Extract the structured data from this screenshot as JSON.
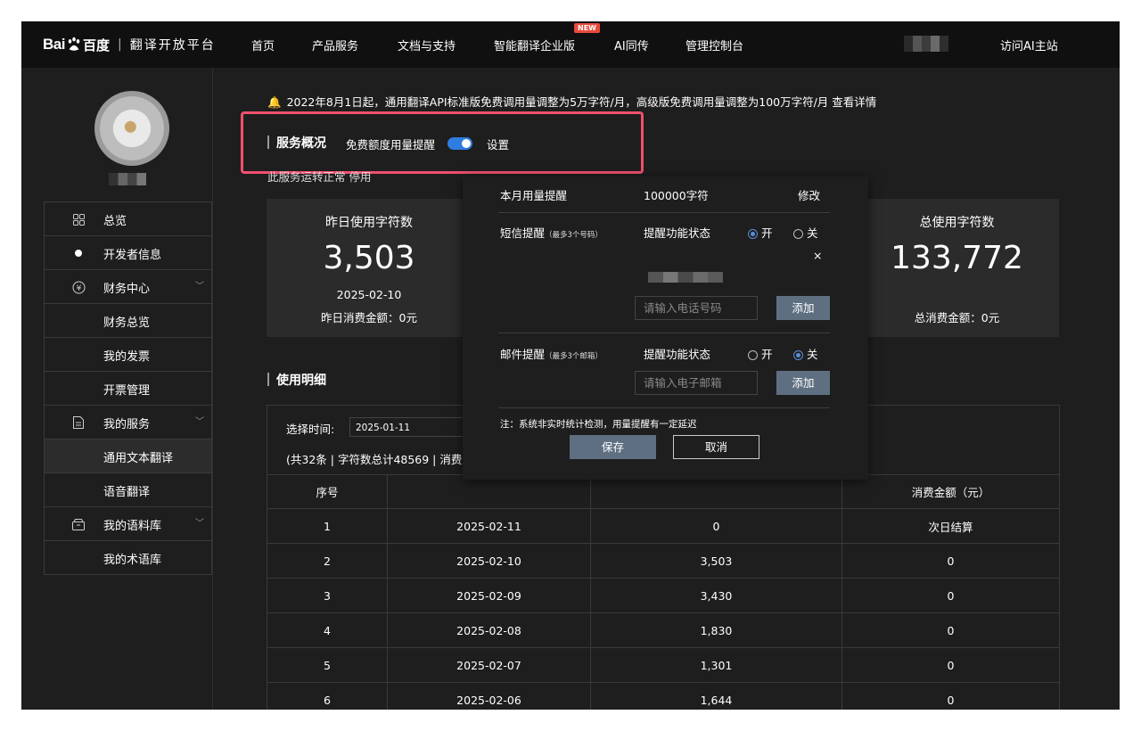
{
  "nav": {
    "logo_bai": "Bai",
    "logo_du": "百度",
    "logo_sub": "翻译开放平台",
    "items": [
      "首页",
      "产品服务",
      "文档与支持",
      "智能翻译企业版",
      "AI同传",
      "管理控制台"
    ],
    "badge": "NEW",
    "visit": "访问AI主站"
  },
  "sidebar": {
    "items": [
      {
        "label": "总览",
        "icon": "grid-icon"
      },
      {
        "label": "开发者信息",
        "icon": "dot-icon"
      },
      {
        "label": "财务中心",
        "icon": "yen-icon"
      },
      {
        "label": "财务总览"
      },
      {
        "label": "我的发票"
      },
      {
        "label": "开票管理"
      },
      {
        "label": "我的服务",
        "icon": "document-icon"
      },
      {
        "label": "通用文本翻译"
      },
      {
        "label": "语音翻译"
      },
      {
        "label": "我的语料库",
        "icon": "box-icon"
      },
      {
        "label": "我的术语库"
      }
    ]
  },
  "notice": "2022年8月1日起，通用翻译API标准版免费调用量调整为5万字符/月，高级版免费调用量调整为100万字符/月 查看详情",
  "overview": {
    "title": "服务概况",
    "toggle_label": "免费额度用量提醒",
    "toggle_on": true,
    "settings": "设置",
    "status": "此服务运转正常  停用"
  },
  "cards": {
    "yesterday": {
      "title": "昨日使用字符数",
      "value": "3,503",
      "date": "2025-02-10",
      "cost": "昨日消费金额：0元"
    },
    "total": {
      "title": "总使用字符数",
      "value": "133,772",
      "cost": "总消费金额：0元"
    }
  },
  "usage": {
    "title": "使用明细",
    "filter_label": "选择时间:",
    "date_value": "2025-01-11",
    "summary": "(共32条 | 字符数总计48569 | 消费",
    "headers": [
      "序号",
      "",
      "",
      "消费金额（元）"
    ],
    "rows": [
      [
        "1",
        "2025-02-11",
        "0",
        "次日结算"
      ],
      [
        "2",
        "2025-02-10",
        "3,503",
        "0"
      ],
      [
        "3",
        "2025-02-09",
        "3,430",
        "0"
      ],
      [
        "4",
        "2025-02-08",
        "1,830",
        "0"
      ],
      [
        "5",
        "2025-02-07",
        "1,301",
        "0"
      ],
      [
        "6",
        "2025-02-06",
        "1,644",
        "0"
      ]
    ]
  },
  "popup": {
    "monthly_label": "本月用量提醒",
    "monthly_value": "100000字符",
    "edit": "修改",
    "sms_label": "短信提醒",
    "sms_note": "（最多3个号码）",
    "status_label": "提醒功能状态",
    "on": "开",
    "off": "关",
    "sms_state": "on",
    "remove": "×",
    "phone_placeholder": "请输入电话号码",
    "add": "添加",
    "email_label": "邮件提醒",
    "email_note": "（最多3个邮箱）",
    "email_state": "off",
    "email_placeholder": "请输入电子邮箱",
    "note": "注：系统非实时统计检测，用量提醒有一定延迟",
    "save": "保存",
    "cancel": "取消"
  }
}
